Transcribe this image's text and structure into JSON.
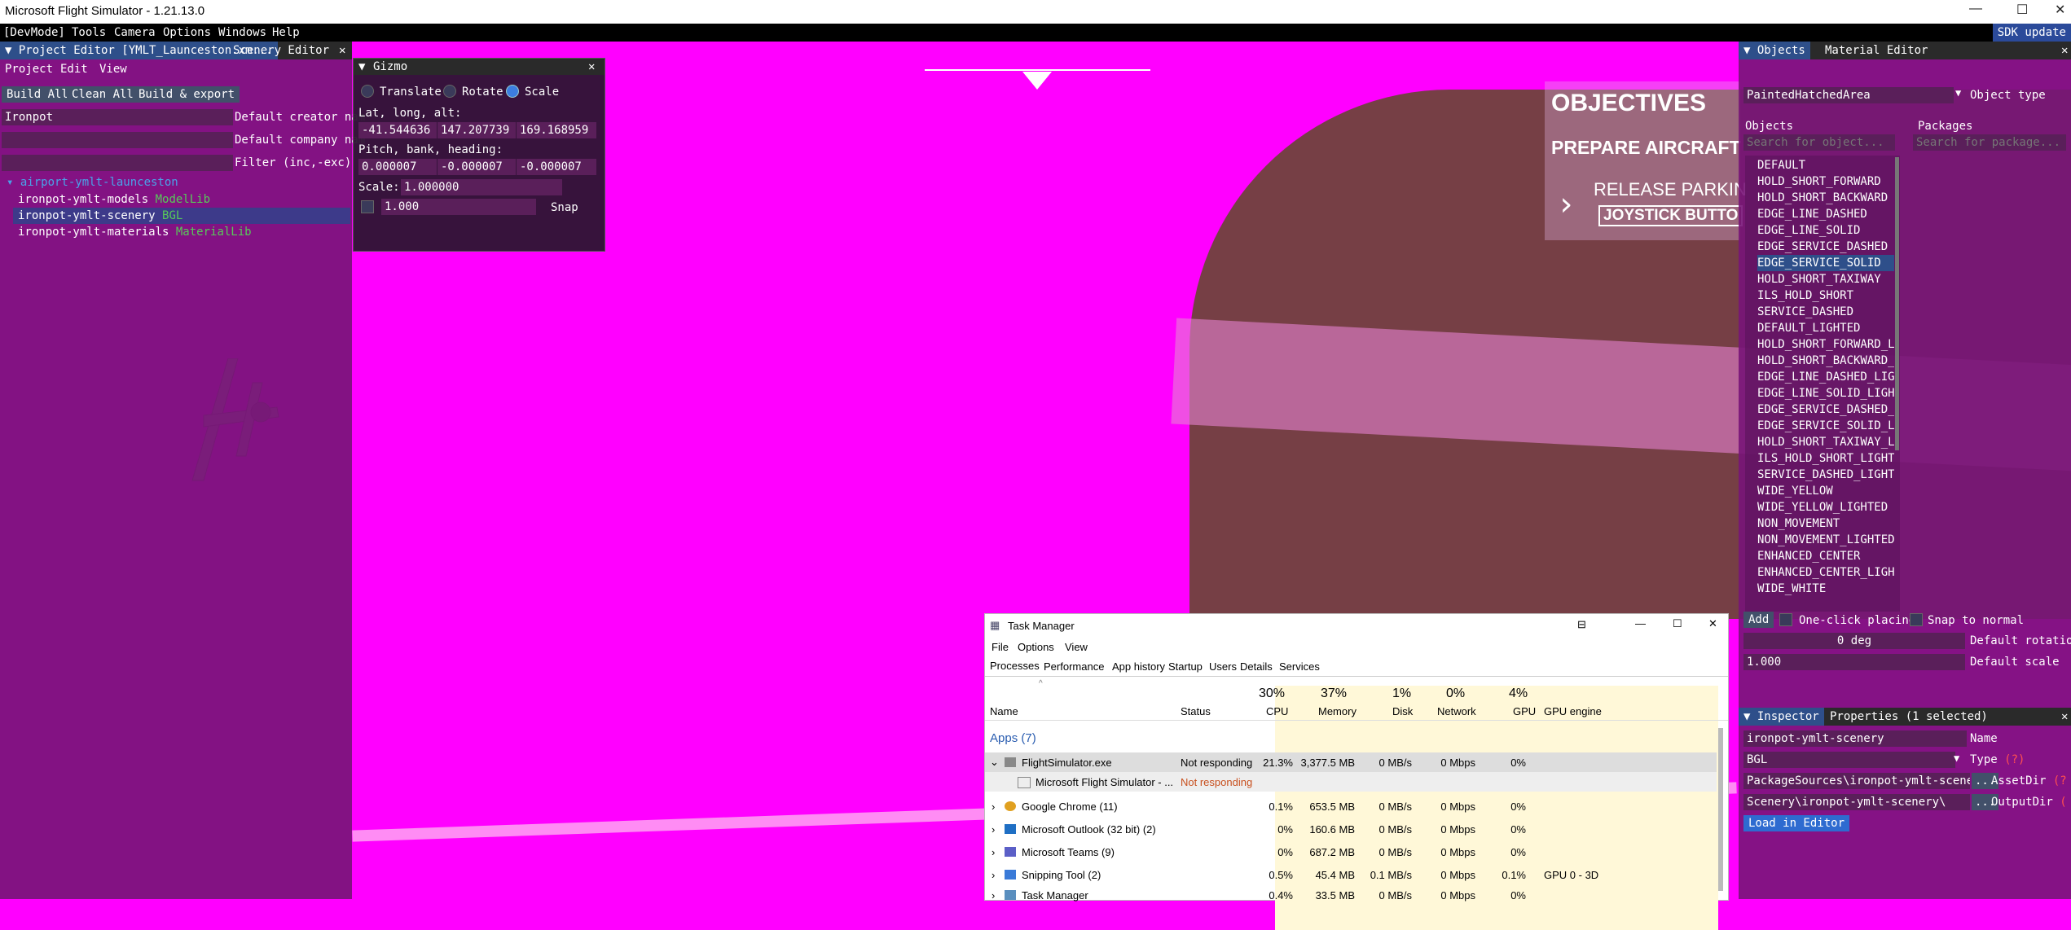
{
  "window": {
    "title": "Microsoft Flight Simulator - 1.21.13.0",
    "minimize": "—",
    "maximize": "☐",
    "close": "✕"
  },
  "menubar": {
    "items": [
      "[DevMode]",
      "Tools",
      "Camera",
      "Options",
      "Windows",
      "Help"
    ],
    "sdk_update": "SDK update"
  },
  "project_editor": {
    "tabs": [
      "Project Editor [YMLT_Launceston.xm...",
      "Scenery Editor"
    ],
    "close": "✕",
    "menu": [
      "Project",
      "Edit",
      "View"
    ],
    "buttons": [
      "Build All",
      "Clean All",
      "Build & export"
    ],
    "creator_value": "Ironpot",
    "creator_label": "Default creator nam",
    "company_value": "",
    "company_label": "Default company nam",
    "filter_label": "Filter (inc,-exc)",
    "tree_root": "airport-ymlt-launceston",
    "tree_items": [
      {
        "name": "ironpot-ymlt-models",
        "type": "ModelLib"
      },
      {
        "name": "ironpot-ymlt-scenery",
        "type": "BGL"
      },
      {
        "name": "ironpot-ymlt-materials",
        "type": "MaterialLib"
      }
    ]
  },
  "gizmo": {
    "title": "Gizmo",
    "close": "✕",
    "modes": [
      "Translate",
      "Rotate",
      "Scale"
    ],
    "lla_label": "Lat, long, alt:",
    "lla": [
      "-41.544636",
      "147.207739",
      "169.168959"
    ],
    "pbh_label": "Pitch, bank, heading:",
    "pbh": [
      "0.000007",
      "-0.000007",
      "-0.000007"
    ],
    "scale_label": "Scale:",
    "scale_value": "1.000000",
    "snap_value": "1.000",
    "snap_label": "Snap"
  },
  "hud": {
    "objectives": "OBJECTIVES",
    "prepare": "PREPARE AIRCRAFT",
    "release": "RELEASE PARKIN",
    "joystick": "JOYSTICK BUTTO"
  },
  "objects_panel": {
    "tabs": [
      "Objects",
      "Material Editor"
    ],
    "object_type_value": "PaintedHatchedArea",
    "object_type_label": "Object type",
    "objects_label": "Objects",
    "packages_label": "Packages",
    "search_objects_placeholder": "Search for object...",
    "search_packages_placeholder": "Search for package...",
    "items": [
      "DEFAULT",
      "HOLD_SHORT_FORWARD",
      "HOLD_SHORT_BACKWARD",
      "EDGE_LINE_DASHED",
      "EDGE_LINE_SOLID",
      "EDGE_SERVICE_DASHED",
      "EDGE_SERVICE_SOLID",
      "HOLD_SHORT_TAXIWAY",
      "ILS_HOLD_SHORT",
      "SERVICE_DASHED",
      "DEFAULT_LIGHTED",
      "HOLD_SHORT_FORWARD_LIGH",
      "HOLD_SHORT_BACKWARD_LIG",
      "EDGE_LINE_DASHED_LIGHTE",
      "EDGE_LINE_SOLID_LIGHTED",
      "EDGE_SERVICE_DASHED_LIG",
      "EDGE_SERVICE_SOLID_LIGH",
      "HOLD_SHORT_TAXIWAY_LIGH",
      "ILS_HOLD_SHORT_LIGHTED",
      "SERVICE_DASHED_LIGHTED",
      "WIDE_YELLOW",
      "WIDE_YELLOW_LIGHTED",
      "NON_MOVEMENT",
      "NON_MOVEMENT_LIGHTED",
      "ENHANCED_CENTER",
      "ENHANCED_CENTER_LIGHTED",
      "WIDE_WHITE"
    ],
    "add": "Add",
    "one_click": "One-click placing",
    "snap_normal": "Snap to normal",
    "rotation_value": "0 deg",
    "rotation_label": "Default rotation",
    "scale_value": "1.000",
    "scale_label": "Default scale"
  },
  "inspector": {
    "tabs": [
      "Inspector",
      "Properties (1 selected)"
    ],
    "name_value": "ironpot-ymlt-scenery",
    "name_label": "Name",
    "type_value": "BGL",
    "type_label": "Type",
    "type_hint": "(?)",
    "assetdir_value": "PackageSources\\ironpot-ymlt-scenery\\",
    "assetdir_label": "AssetDir",
    "assetdir_hint": "(?",
    "outputdir_value": "Scenery\\ironpot-ymlt-scenery\\",
    "outputdir_label": "OutputDir",
    "outputdir_hint": "(",
    "browse": "...",
    "load": "Load in Editor"
  },
  "task_manager": {
    "title": "Task Manager",
    "menu": [
      "File",
      "Options",
      "View"
    ],
    "tabs": [
      "Processes",
      "Performance",
      "App history",
      "Startup",
      "Users",
      "Details",
      "Services"
    ],
    "columns": {
      "name": "Name",
      "status": "Status",
      "cpu": "CPU",
      "memory": "Memory",
      "disk": "Disk",
      "network": "Network",
      "gpu": "GPU",
      "gpu_engine": "GPU engine"
    },
    "totals": {
      "cpu": "30%",
      "memory": "37%",
      "disk": "1%",
      "network": "0%",
      "gpu": "4%"
    },
    "group": "Apps (7)",
    "rows": [
      {
        "name": "FlightSimulator.exe",
        "status": "Not responding",
        "cpu": "21.3%",
        "memory": "3,377.5 MB",
        "disk": "0 MB/s",
        "network": "0 Mbps",
        "gpu": "0%",
        "engine": ""
      },
      {
        "name": "Microsoft Flight Simulator - ...",
        "status": "Not responding",
        "cpu": "",
        "memory": "",
        "disk": "",
        "network": "",
        "gpu": "",
        "engine": ""
      },
      {
        "name": "Google Chrome (11)",
        "status": "",
        "cpu": "0.1%",
        "memory": "653.5 MB",
        "disk": "0 MB/s",
        "network": "0 Mbps",
        "gpu": "0%",
        "engine": ""
      },
      {
        "name": "Microsoft Outlook (32 bit) (2)",
        "status": "",
        "cpu": "0%",
        "memory": "160.6 MB",
        "disk": "0 MB/s",
        "network": "0 Mbps",
        "gpu": "0%",
        "engine": ""
      },
      {
        "name": "Microsoft Teams (9)",
        "status": "",
        "cpu": "0%",
        "memory": "687.2 MB",
        "disk": "0 MB/s",
        "network": "0 Mbps",
        "gpu": "0%",
        "engine": ""
      },
      {
        "name": "Snipping Tool (2)",
        "status": "",
        "cpu": "0.5%",
        "memory": "45.4 MB",
        "disk": "0.1 MB/s",
        "network": "0 Mbps",
        "gpu": "0.1%",
        "engine": "GPU 0 - 3D"
      },
      {
        "name": "Task Manager",
        "status": "",
        "cpu": "0.4%",
        "memory": "33.5 MB",
        "disk": "0 MB/s",
        "network": "0 Mbps",
        "gpu": "0%",
        "engine": ""
      }
    ]
  }
}
